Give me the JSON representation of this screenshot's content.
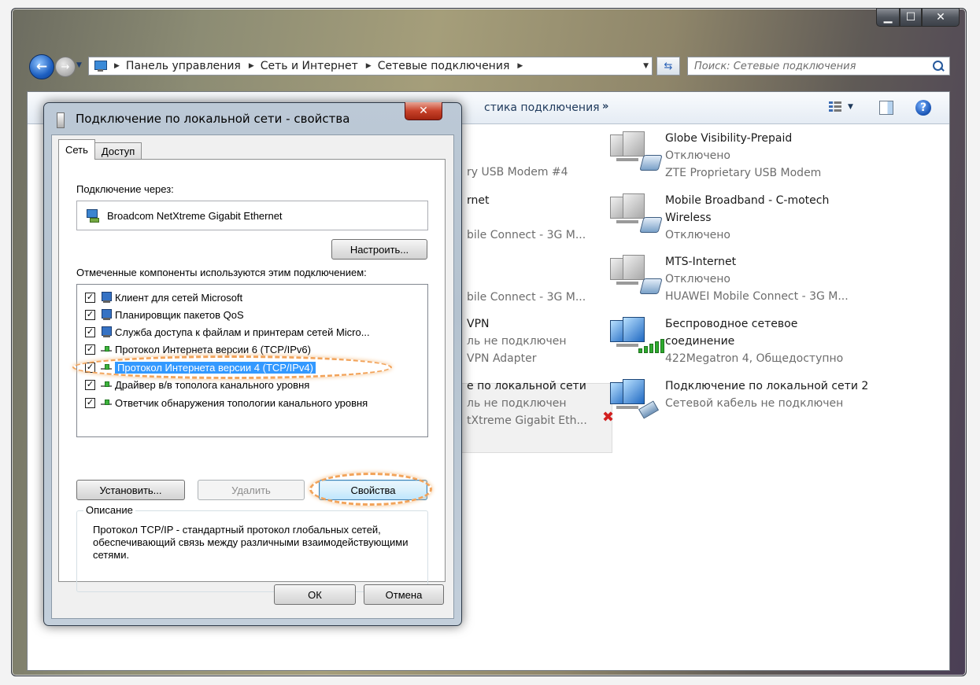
{
  "explorer": {
    "breadcrumb": [
      "Панель управления",
      "Сеть и Интернет",
      "Сетевые подключения"
    ],
    "search_placeholder": "Поиск: Сетевые подключения",
    "command_bar": {
      "partial_item": "стика подключения",
      "more": "»"
    },
    "icons": [
      "back-arrow-icon",
      "forward-arrow-icon",
      "refresh-icon",
      "search-icon",
      "view-options-icon",
      "preview-pane-icon",
      "help-icon"
    ]
  },
  "connections_right": [
    {
      "name": "Globe Visibility-Prepaid",
      "status": "Отключено",
      "device": "ZTE Proprietary USB Modem"
    },
    {
      "name": "Mobile Broadband - C-motech Wireless",
      "status": "Отключено",
      "device": ""
    },
    {
      "name": "MTS-Internet",
      "status": "Отключено",
      "device": "HUAWEI Mobile Connect - 3G M..."
    },
    {
      "name": "Беспроводное сетевое соединение",
      "status": "",
      "device": "422Megatron 4, Общедоступно"
    },
    {
      "name": "Подключение по локальной сети 2",
      "status": "",
      "device": "Сетевой кабель не подключен"
    }
  ],
  "connections_partial": {
    "row1": "ry USB Modem #4",
    "row2_name": "rnet",
    "row2_dev": "bile Connect - 3G M...",
    "row3_dev": "bile Connect - 3G M...",
    "row4_name": "VPN",
    "row4_status": "ль не подключен",
    "row4_dev": "VPN Adapter",
    "row5_name": "е по локальной сети",
    "row5_status": "ль не подключен",
    "row5_dev": "tXtreme Gigabit Eth..."
  },
  "dialog": {
    "title": "Подключение по локальной сети - свойства",
    "tabs": [
      "Сеть",
      "Доступ"
    ],
    "connect_using_label": "Подключение через:",
    "adapter": "Broadcom NetXtreme Gigabit Ethernet",
    "configure_button": "Настроить...",
    "components_label": "Отмеченные компоненты используются этим подключением:",
    "components": [
      {
        "label": "Клиент для сетей Microsoft",
        "checked": true,
        "icon": "network-client-icon"
      },
      {
        "label": "Планировщик пакетов QoS",
        "checked": true,
        "icon": "qos-scheduler-icon"
      },
      {
        "label": "Служба доступа к файлам и принтерам сетей Micro...",
        "checked": true,
        "icon": "file-sharing-icon"
      },
      {
        "label": "Протокол Интернета версии 6 (TCP/IPv6)",
        "checked": true,
        "icon": "protocol-icon"
      },
      {
        "label": "Протокол Интернета версии 4 (TCP/IPv4)",
        "checked": true,
        "icon": "protocol-icon",
        "selected": true
      },
      {
        "label": "Драйвер в/в тополога канального уровня",
        "checked": true,
        "icon": "protocol-icon"
      },
      {
        "label": "Ответчик обнаружения топологии канального уровня",
        "checked": true,
        "icon": "protocol-icon"
      }
    ],
    "install_button": "Установить...",
    "uninstall_button": "Удалить",
    "properties_button": "Свойства",
    "description_label": "Описание",
    "description": "Протокол TCP/IP - стандартный протокол глобальных сетей, обеспечивающий связь между различными взаимодействующими сетями.",
    "ok_button": "ОК",
    "cancel_button": "Отмена",
    "check_mark": "✓"
  },
  "colors": {
    "selection": "#3399ff",
    "highlight_oval": "#f2a35a",
    "close_red": "#c8422a"
  }
}
